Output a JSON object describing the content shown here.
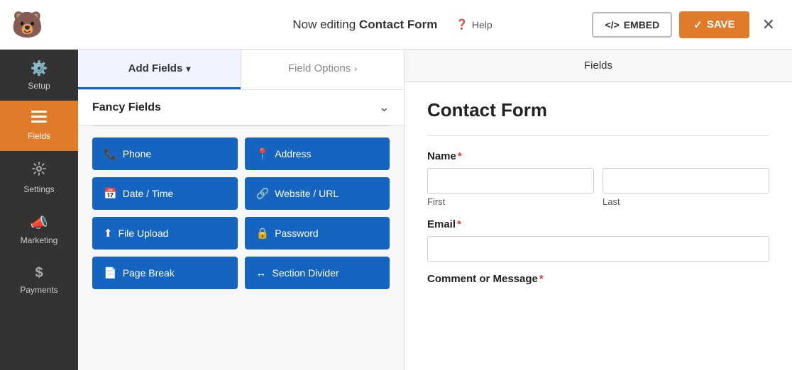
{
  "topbar": {
    "editing_prefix": "Now editing ",
    "form_name": "Contact Form",
    "help_label": "Help",
    "embed_label": "EMBED",
    "save_label": "SAVE"
  },
  "sidebar": {
    "items": [
      {
        "id": "setup",
        "label": "Setup",
        "icon": "⚙️",
        "active": false
      },
      {
        "id": "fields",
        "label": "Fields",
        "icon": "☰",
        "active": true
      },
      {
        "id": "settings",
        "label": "Settings",
        "icon": "⚙",
        "active": false
      },
      {
        "id": "marketing",
        "label": "Marketing",
        "icon": "📣",
        "active": false
      },
      {
        "id": "payments",
        "label": "Payments",
        "icon": "$",
        "active": false
      }
    ]
  },
  "middle": {
    "tab_add_fields": "Add Fields",
    "tab_field_options": "Field Options",
    "fancy_fields_label": "Fancy Fields",
    "fields": [
      {
        "id": "phone",
        "label": "Phone",
        "icon": "📞"
      },
      {
        "id": "address",
        "label": "Address",
        "icon": "📍"
      },
      {
        "id": "datetime",
        "label": "Date / Time",
        "icon": "📅"
      },
      {
        "id": "website",
        "label": "Website / URL",
        "icon": "🔗"
      },
      {
        "id": "fileupload",
        "label": "File Upload",
        "icon": "⬆"
      },
      {
        "id": "password",
        "label": "Password",
        "icon": "🔒"
      },
      {
        "id": "pagebreak",
        "label": "Page Break",
        "icon": "📄"
      },
      {
        "id": "sectiondivider",
        "label": "Section Divider",
        "icon": "↔"
      }
    ]
  },
  "preview": {
    "tab_label": "Fields",
    "form_title": "Contact Form",
    "name_label": "Name",
    "name_first": "First",
    "name_last": "Last",
    "email_label": "Email",
    "comment_label": "Comment or Message"
  }
}
